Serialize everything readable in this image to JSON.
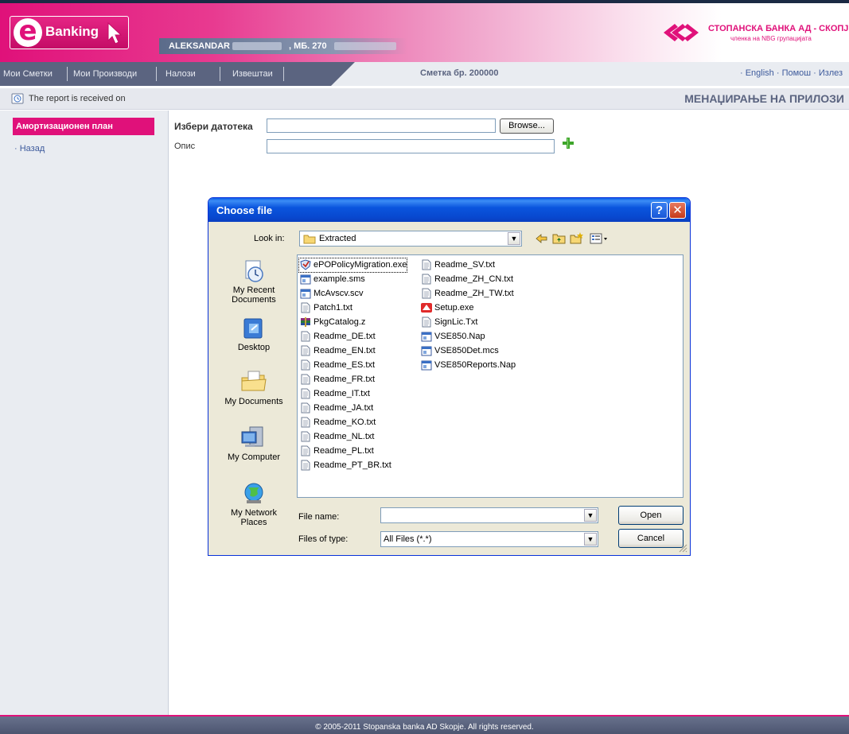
{
  "header": {
    "logo_text": "Banking",
    "user_name": "ALEKSANDAR",
    "user_mb": ", МБ. 270",
    "bank_name": "СТОПАНСКА БАНКА АД - СКОПЈЕ",
    "bank_subtitle": "членка на NBG групацијата",
    "brand_color": "#e0117a",
    "nav_color": "#5b6480"
  },
  "nav": {
    "items": [
      {
        "label": "Мои Сметки"
      },
      {
        "label": "Мои Производи"
      },
      {
        "label": "Налози"
      },
      {
        "label": "Извештаи"
      }
    ],
    "account": "Сметка бр. 200000",
    "right_links": "· English · Помош · Излез"
  },
  "info_bar": {
    "report_text": "The report is received on",
    "page_title": "МЕНАЏИРАЊЕ НА ПРИЛОЗИ"
  },
  "sidebar": {
    "heading": "Амортизационен план",
    "back_link": "· Назад"
  },
  "form": {
    "file_label": "Избери датотека",
    "browse_label": "Browse...",
    "desc_label": "Опис"
  },
  "dialog": {
    "title": "Choose file",
    "help_label": "?",
    "close_label": "✕",
    "look_in_label": "Look in:",
    "look_in_value": "Extracted",
    "places": [
      {
        "label": "My Recent Documents",
        "icon": "recent-documents-icon"
      },
      {
        "label": "Desktop",
        "icon": "desktop-icon"
      },
      {
        "label": "My Documents",
        "icon": "my-documents-icon"
      },
      {
        "label": "My Computer",
        "icon": "my-computer-icon"
      },
      {
        "label": "My Network Places",
        "icon": "network-places-icon"
      }
    ],
    "files_col1": [
      {
        "name": "ePOPolicyMigration.exe",
        "type": "exe"
      },
      {
        "name": "example.sms",
        "type": "data"
      },
      {
        "name": "McAvscv.scv",
        "type": "data"
      },
      {
        "name": "Patch1.txt",
        "type": "txt"
      },
      {
        "name": "PkgCatalog.z",
        "type": "archive"
      },
      {
        "name": "Readme_DE.txt",
        "type": "txt"
      },
      {
        "name": "Readme_EN.txt",
        "type": "txt"
      },
      {
        "name": "Readme_ES.txt",
        "type": "txt"
      },
      {
        "name": "Readme_FR.txt",
        "type": "txt"
      },
      {
        "name": "Readme_IT.txt",
        "type": "txt"
      },
      {
        "name": "Readme_JA.txt",
        "type": "txt"
      },
      {
        "name": "Readme_KO.txt",
        "type": "txt"
      },
      {
        "name": "Readme_NL.txt",
        "type": "txt"
      },
      {
        "name": "Readme_PL.txt",
        "type": "txt"
      },
      {
        "name": "Readme_PT_BR.txt",
        "type": "txt"
      }
    ],
    "files_col2": [
      {
        "name": "Readme_SV.txt",
        "type": "txt"
      },
      {
        "name": "Readme_ZH_CN.txt",
        "type": "txt"
      },
      {
        "name": "Readme_ZH_TW.txt",
        "type": "txt"
      },
      {
        "name": "Setup.exe",
        "type": "setup"
      },
      {
        "name": "SignLic.Txt",
        "type": "txt"
      },
      {
        "name": "VSE850.Nap",
        "type": "data"
      },
      {
        "name": "VSE850Det.mcs",
        "type": "data"
      },
      {
        "name": "VSE850Reports.Nap",
        "type": "data"
      }
    ],
    "file_name_label": "File name:",
    "file_name_value": "",
    "files_of_type_label": "Files of type:",
    "files_of_type_value": "All Files (*.*)",
    "open_label": "Open",
    "cancel_label": "Cancel"
  },
  "footer": {
    "text": "© 2005-2011 Stopanska banka AD Skopje. All rights reserved."
  }
}
